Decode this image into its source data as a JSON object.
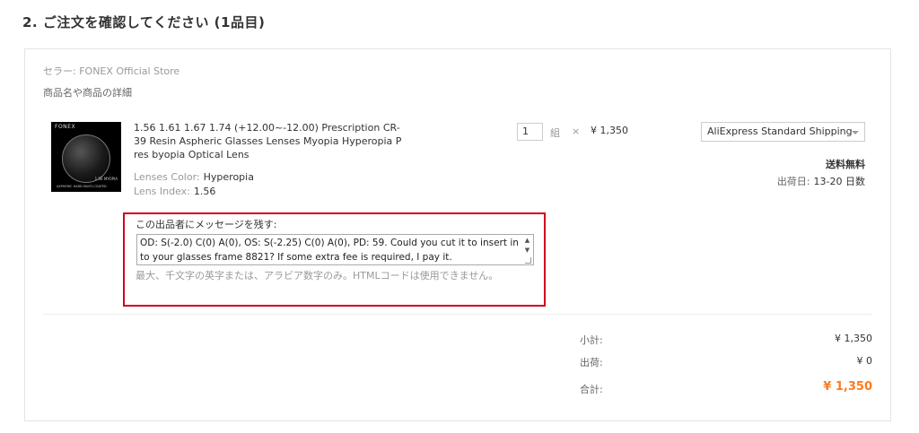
{
  "section": {
    "title": "2. ご注文を確認してください (1品目)"
  },
  "store": {
    "line": "セラー: FONEX Official Store"
  },
  "detail_header": "商品名や商品の詳細",
  "product": {
    "image_brand": "FONEX",
    "image_caption_1": "1.56 MYOPIA",
    "image_caption_2": "ASPHERIC HARD MULTI-COATED",
    "title": "1.56 1.61 1.67 1.74 (+12.00~-12.00) Prescription CR-39 Resin Aspheric Glasses Lenses Myopia Hyperopia Pres byopia Optical Lens",
    "attr_color_label": "Lenses Color:",
    "attr_color_value": "Hyperopia",
    "attr_index_label": "Lens Index:",
    "attr_index_value": "1.56"
  },
  "quantity": {
    "value": "1",
    "unit": "組",
    "times": "×",
    "unit_price": "¥ 1,350"
  },
  "shipping": {
    "selected": "AliExpress Standard Shipping",
    "free": "送料無料",
    "date_label": "出荷日:",
    "date_value": "13-20 日数"
  },
  "message": {
    "label": "この出品者にメッセージを残す:",
    "value": "OD: S(-2.0) C(0) A(0), OS: S(-2.25) C(0) A(0), PD: 59. Could you cut it to insert in to your glasses frame 8821? If some extra fee is required, I pay it.",
    "help": "最大、千文字の英字または、アラビア数字のみ。HTMLコードは使用できません。"
  },
  "summary": {
    "subtotal_label": "小計:",
    "subtotal_value": "¥ 1,350",
    "shipping_label": "出荷:",
    "shipping_value": "¥ 0",
    "total_label": "合計:",
    "total_value": "¥ 1,350"
  },
  "colors": {
    "highlight_border": "#d0021b",
    "total_accent": "#ff7a1a"
  }
}
